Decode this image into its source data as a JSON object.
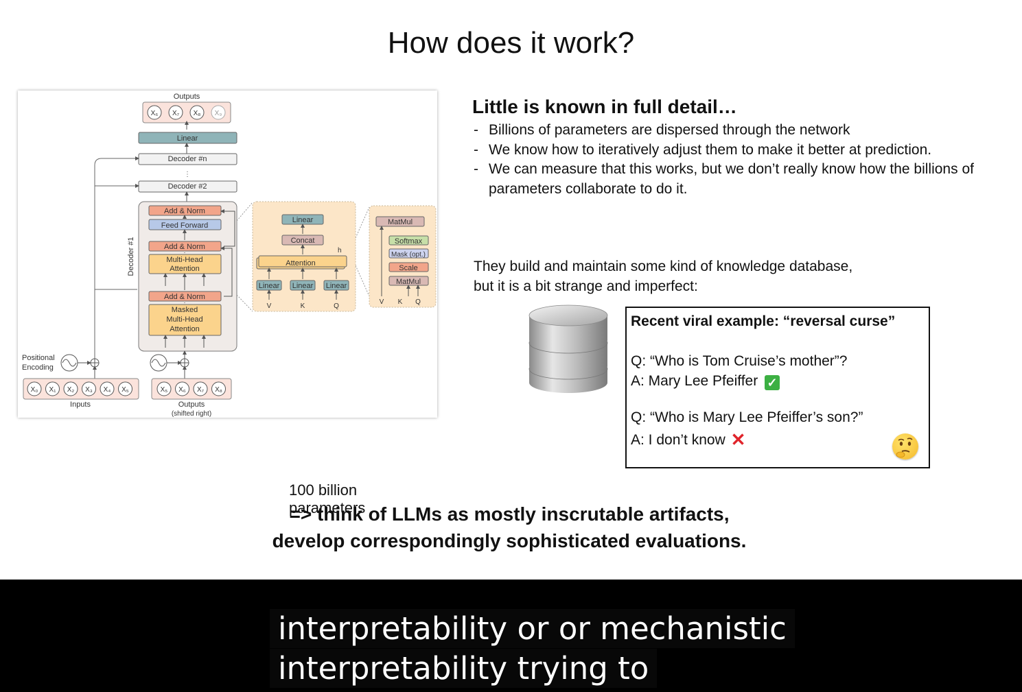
{
  "slide": {
    "title": "How does it work?",
    "diagram": {
      "outputs_label": "Outputs",
      "output_tokens": [
        "X₆",
        "X₇",
        "X₈",
        "X₉"
      ],
      "linear_label": "Linear",
      "decoder_n_label": "Decoder #n",
      "decoder_2_label": "Decoder #2",
      "decoder_1_label": "Decoder #1",
      "add_norm_label": "Add & Norm",
      "feed_forward_label": "Feed Forward",
      "multi_head_label": "Multi-Head\nAttention",
      "masked_label": "Masked\nMulti-Head\nAttention",
      "positional_label": "Positional\nEncoding",
      "input_tokens": [
        "X₀",
        "X₁",
        "X₂",
        "X₃",
        "X₄",
        "X₅"
      ],
      "shifted_tokens": [
        "X₅",
        "X₆",
        "X₇",
        "X₈"
      ],
      "inputs_label": "Inputs",
      "outputs_shifted_label": "Outputs",
      "shifted_right_label": "(shifted right)",
      "mha_linear": "Linear",
      "mha_concat": "Concat",
      "mha_attention": "Attention",
      "mha_h": "h",
      "mha_vkq": [
        "V",
        "K",
        "Q"
      ],
      "sdpa_matmul": "MatMul",
      "sdpa_softmax": "Softmax",
      "sdpa_mask": "Mask (opt.)",
      "sdpa_scale": "Scale"
    },
    "params_label": "100 billion parameters",
    "heading": "Little is known in full detail…",
    "bullets": [
      "Billions of parameters are dispersed through the network",
      "We know how to iteratively adjust them to make it better at prediction.",
      "We can measure that this works, but we don’t really know how the billions of parameters collaborate to do it."
    ],
    "knowledge_text": "They build and maintain some kind of knowledge database, but it is a bit strange and imperfect:",
    "example": {
      "title": "Recent viral example: “reversal curse”",
      "q1": "Q: “Who is Tom Cruise’s mother”?",
      "a1": "A: Mary Lee Pfeiffer",
      "q2": "Q: “Who is Mary Lee Pfeiffer’s son?”",
      "a2": "A: I don’t know",
      "check_icon": "✓",
      "cross_icon": "✕"
    },
    "conclusion_line1": "=> think of LLMs as mostly inscrutable artifacts,",
    "conclusion_line2": "develop correspondingly sophisticated evaluations."
  },
  "captions": {
    "line1": "interpretability or or mechanistic",
    "line2": "interpretability trying to"
  }
}
